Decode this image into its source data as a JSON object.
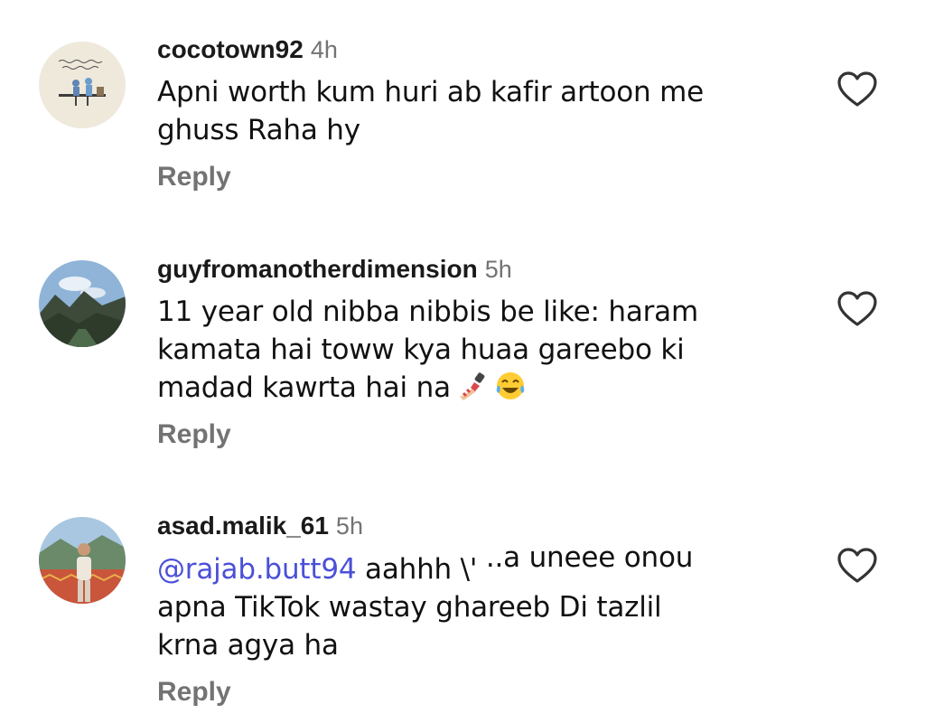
{
  "comments": [
    {
      "username": "cocotown92",
      "time": "4h",
      "lines": [
        "Apni worth kum huri ab kafir artoon me",
        "ghuss Raha hy"
      ],
      "reply_label": "Reply",
      "avatar_icon": "avatar-urdu-poetry-image",
      "like_icon": "heart-outline-icon"
    },
    {
      "username": "guyfromanotherdimension",
      "time": "5h",
      "lines": [
        "11 year old nibba nibbis be like: haram",
        "kamata hai toww kya huaa gareebo ki",
        "madad kawrta hai na"
      ],
      "emojis": [
        "nail-polish-emoji",
        "tears-of-joy-emoji"
      ],
      "reply_label": "Reply",
      "avatar_icon": "avatar-mountain-landscape",
      "like_icon": "heart-outline-icon"
    },
    {
      "username": "asad.malik_61",
      "time": "5h",
      "mention": "@rajab.butt94",
      "line1_text": "aahhh \\'",
      "line1_clipped": "..a uneee onou",
      "lines": [
        "apna TikTok wastay ghareeb Di tazlil",
        "krna agya ha"
      ],
      "reply_label": "Reply",
      "avatar_icon": "avatar-man-portrait",
      "like_icon": "heart-outline-icon"
    }
  ],
  "colors": {
    "username": "#1a1a1a",
    "secondary_text": "#737373",
    "mention": "#4a50d8",
    "body_text": "#111111"
  }
}
